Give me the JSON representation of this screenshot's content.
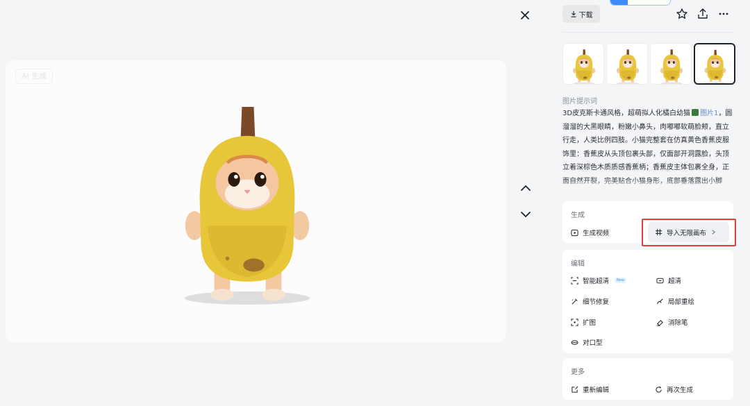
{
  "viewer": {
    "watermark": "AI 生成",
    "close_icon": "close-icon",
    "prev_icon": "chevron-up-icon",
    "next_icon": "chevron-down-icon"
  },
  "toolbar": {
    "download_label": "下载",
    "icons": [
      "star-icon",
      "share-icon",
      "more-icon"
    ]
  },
  "thumbnails": [
    {
      "label": "banana-cat-1",
      "selected": false
    },
    {
      "label": "banana-cat-2",
      "selected": false
    },
    {
      "label": "banana-cat-3",
      "selected": false
    },
    {
      "label": "banana-cat-4",
      "selected": true
    }
  ],
  "prompt": {
    "title": "图片提示词",
    "text_before": "3D皮克斯卡通风格，超萌拟人化橘白幼猫",
    "ref_label": "图片1",
    "text_after": "，圆溜溜的大黑眼睛，粉嫩小鼻头，肉嘟嘟软萌脸颊，直立行走，人类比例四肢。小猫完整套在仿真黄色香蕉皮服饰里：香蕉皮从头顶包裹头部，仅面部开洞露脸，头顶立着深棕色木质质感香蕉柄；香蕉皮主体包裹全身，正面自然开裂，完美贴合小猫身形，底部垂落露出小脚丫。香蕉皮为明亮饱和的鲜黄色，表面有清晰真实的果皮纹理，底部带自然分布的深褐色斑点。"
  },
  "generate": {
    "title": "生成",
    "video_label": "生成视频",
    "import_label": "导入无限画布"
  },
  "edit": {
    "title": "编辑",
    "items": [
      {
        "label": "智能超清",
        "badge": "New",
        "icon": "smart-hd-icon"
      },
      {
        "label": "超清",
        "icon": "hd-icon"
      },
      {
        "label": "细节修复",
        "icon": "repair-icon"
      },
      {
        "label": "局部重绘",
        "icon": "repaint-icon"
      },
      {
        "label": "扩图",
        "icon": "expand-icon"
      },
      {
        "label": "消除笔",
        "icon": "eraser-icon"
      },
      {
        "label": "对口型",
        "icon": "lip-sync-icon"
      }
    ]
  },
  "more": {
    "title": "更多",
    "reedit_label": "重新编辑",
    "regen_label": "再次生成"
  },
  "colors": {
    "accent": "#3b8cff",
    "highlight": "#e23d3d",
    "banana": "#e8c63a"
  }
}
